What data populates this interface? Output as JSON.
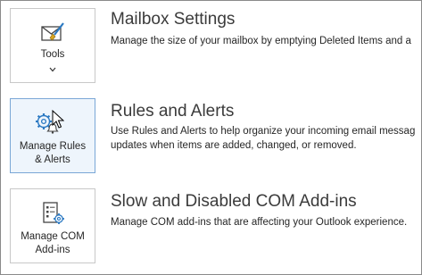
{
  "sections": [
    {
      "tile_label": "Tools",
      "title": "Mailbox Settings",
      "description": "Manage the size of your mailbox by emptying Deleted Items and a"
    },
    {
      "tile_label_line1": "Manage Rules",
      "tile_label_line2": "& Alerts",
      "title": "Rules and Alerts",
      "description_line1": "Use Rules and Alerts to help organize your incoming email messag",
      "description_line2": "updates when items are added, changed, or removed."
    },
    {
      "tile_label_line1": "Manage COM",
      "tile_label_line2": "Add-ins",
      "title": "Slow and Disabled COM Add-ins",
      "description": "Manage COM add-ins that are affecting your Outlook experience."
    }
  ],
  "icons": {
    "tools": "envelope-brush-icon",
    "rules": "gear-bell-icon",
    "com": "document-gear-icon",
    "dropdown": "chevron-down-icon",
    "cursor": "mouse-pointer-icon"
  },
  "colors": {
    "accent_blue": "#2b79c2",
    "selected_tile_bg": "#eef5fc"
  }
}
